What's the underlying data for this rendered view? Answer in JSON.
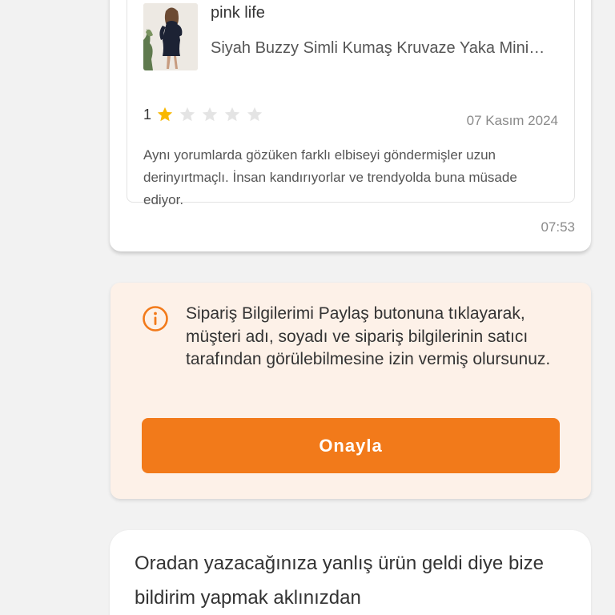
{
  "review_message": {
    "seller_name": "pink life",
    "product_name": "Siyah Buzzy Simli Kumaş Kruvaze Yaka Mini Elbise",
    "rating": "1",
    "rating_value": 1,
    "rating_max": 5,
    "date": "07 Kasım 2024",
    "text": "Aynı yorumlarda gözüken farklı elbiseyi göndermişler uzun derinyırtmaçlı. İnsan kandırıyorlar ve trendyolda buna müsade ediyor.",
    "time": "07:53"
  },
  "consent_card": {
    "icon": "info-circle-icon",
    "text": "Sipariş Bilgilerimi Paylaş butonuna tıklayarak, müşteri adı, soyadı ve sipariş bilgilerinin satıcı tarafından görülebilmesine izin vermiş olursunuz.",
    "approve_label": "Onayla"
  },
  "bottom_message": {
    "text": "Oradan yazacağınıza yanlış ürün geldi diye bize bildirim yapmak aklınızdan"
  },
  "colors": {
    "accent": "#f27a1a",
    "star_filled": "#f9b800",
    "star_empty": "#e4e4e4",
    "info_bg": "#fdf1e8",
    "page_bg": "#f2f2f2"
  }
}
